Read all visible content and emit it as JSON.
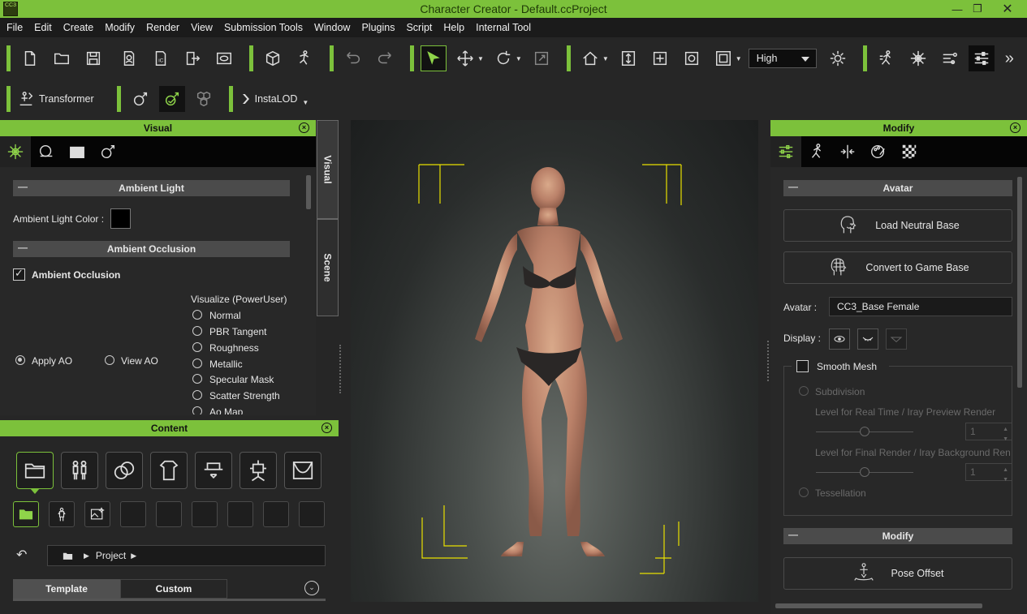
{
  "app": {
    "window_title": "Character Creator - Default.ccProject",
    "icon_text": "CC3"
  },
  "menu": [
    "File",
    "Edit",
    "Create",
    "Modify",
    "Render",
    "View",
    "Submission Tools",
    "Window",
    "Plugins",
    "Script",
    "Help",
    "Internal Tool"
  ],
  "toolbar": {
    "quality_value": "High",
    "more_label": "»"
  },
  "toolbar2": {
    "transformer_label": "Transformer",
    "instalod_label": "InstaLOD"
  },
  "visual_panel": {
    "title": "Visual",
    "sections": {
      "ambient_light": "Ambient Light",
      "ambient_occlusion": "Ambient Occlusion"
    },
    "ambient_light_color_label": "Ambient Light Color :",
    "ambient_light_color": "#000000",
    "ao_checkbox_label": "Ambient Occlusion",
    "ao_checked": true,
    "visualize_label": "Visualize (PowerUser)",
    "visualize_options": [
      "Normal",
      "PBR Tangent",
      "Roughness",
      "Metallic",
      "Specular Mask",
      "Scatter Strength",
      "Ao Map"
    ],
    "apply_ao_label": "Apply AO",
    "view_ao_label": "View AO",
    "side_tabs": [
      "Visual",
      "Scene"
    ]
  },
  "content_panel": {
    "title": "Content",
    "path_root": "Project",
    "tabs": [
      "Template",
      "Custom"
    ]
  },
  "modify_panel": {
    "title": "Modify",
    "avatar_section": "Avatar",
    "load_neutral_base": "Load Neutral Base",
    "convert_game_base": "Convert to Game Base",
    "avatar_label": "Avatar :",
    "avatar_value": "CC3_Base Female",
    "display_label": "Display :",
    "smooth_mesh_label": "Smooth Mesh",
    "subdivision_label": "Subdivision",
    "realtime_label": "Level for Real Time / Iray Preview Render",
    "realtime_value": "1",
    "final_label": "Level for Final Render / Iray Background Ren",
    "final_value": "1",
    "tessellation_label": "Tessellation",
    "modify_section": "Modify",
    "pose_offset": "Pose Offset"
  },
  "colors": {
    "accent": "#7cc13b",
    "bg": "#262626",
    "section": "#4b4b4b",
    "marker": "#e8e000"
  }
}
